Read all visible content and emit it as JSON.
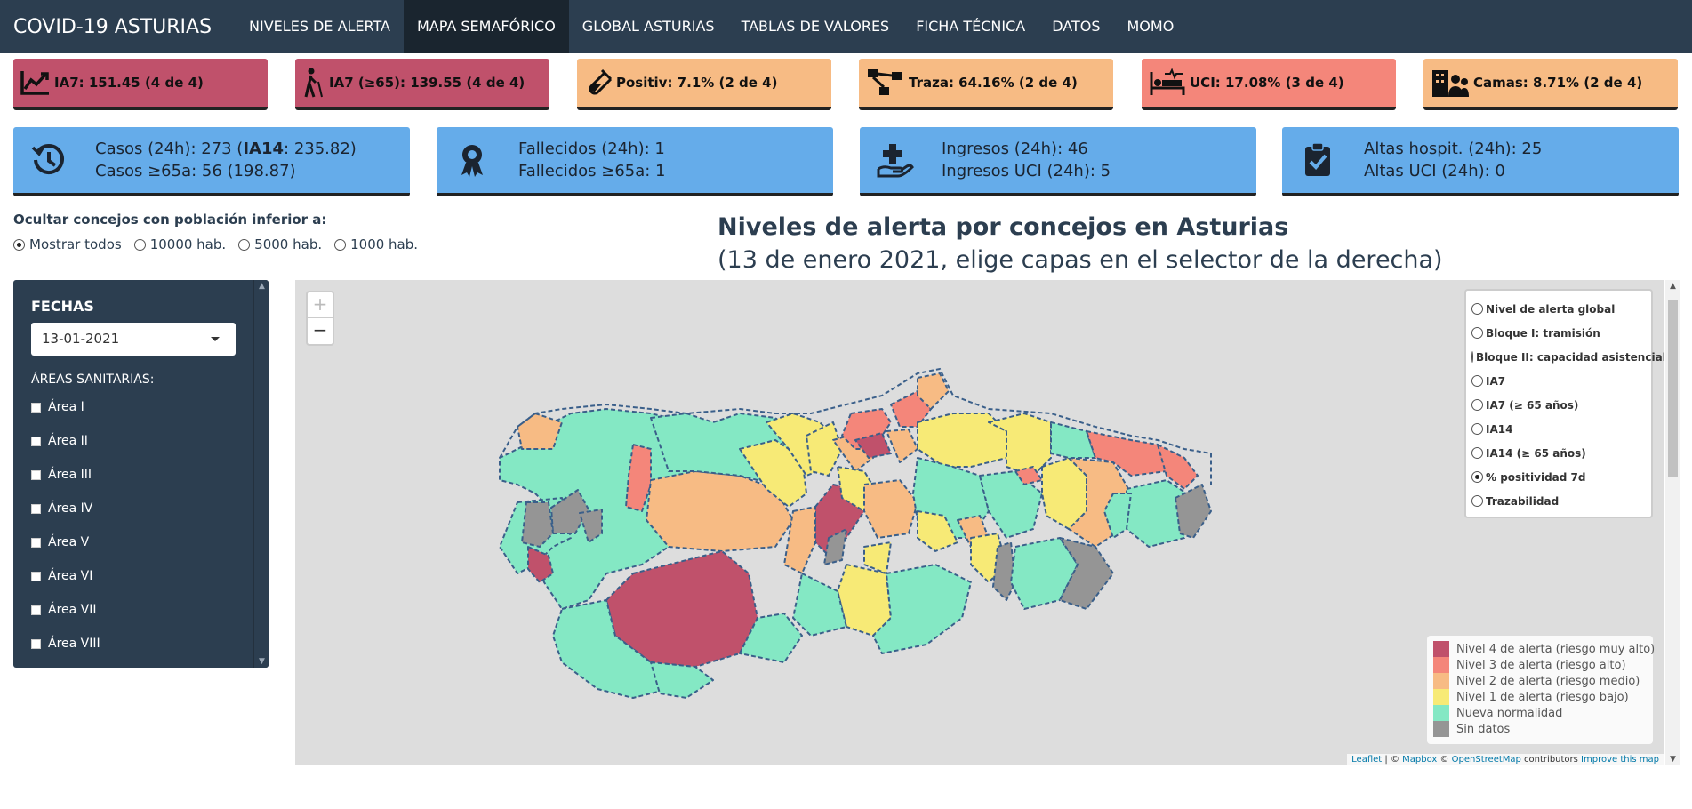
{
  "navbar": {
    "brand": "COVID-19 ASTURIAS",
    "items": [
      {
        "label": "NIVELES DE ALERTA"
      },
      {
        "label": "MAPA SEMAFÓRICO"
      },
      {
        "label": "GLOBAL ASTURIAS"
      },
      {
        "label": "TABLAS DE VALORES"
      },
      {
        "label": "FICHA TÉCNICA"
      },
      {
        "label": "DATOS"
      },
      {
        "label": "MOMO"
      }
    ],
    "active_item": "MAPA SEMAFÓRICO"
  },
  "indicators": [
    {
      "text": "IA7: 151.45 (4 de 4)",
      "icon": "chart-line-icon",
      "color": "#c0516b"
    },
    {
      "text": "IA7 (≥65): 139.55 (4 de 4)",
      "icon": "elderly-person-icon",
      "color": "#c0516b"
    },
    {
      "text": "Positiv: 7.1% (2 de 4)",
      "icon": "test-tube-icon",
      "color": "#f7bb84"
    },
    {
      "text": "Traza: 64.16% (2 de 4)",
      "icon": "network-icon",
      "color": "#f7bb84"
    },
    {
      "text": "UCI: 17.08% (3 de 4)",
      "icon": "hospital-bed-icon",
      "color": "#f4867a"
    },
    {
      "text": "Camas: 8.71% (2 de 4)",
      "icon": "hospital-building-icon",
      "color": "#f7bb84"
    }
  ],
  "info_boxes": [
    {
      "icon": "history-icon",
      "line1_pre": "Casos (24h): 273 (",
      "line1_bold": "IA14",
      "line1_post": ": 235.82)",
      "line2": "Casos ≥65a: 56 (198.87)"
    },
    {
      "icon": "ribbon-icon",
      "line1": "Fallecidos (24h): 1",
      "line2": "Fallecidos ≥65a: 1"
    },
    {
      "icon": "hand-plus-icon",
      "line1": "Ingresos (24h): 46",
      "line2": "Ingresos UCI (24h): 5"
    },
    {
      "icon": "clipboard-check-icon",
      "line1": "Altas hospit. (24h): 25",
      "line2": "Altas UCI (24h): 0"
    }
  ],
  "filter": {
    "title": "Ocultar concejos con población inferior a:",
    "options": [
      "Mostrar todos",
      "10000 hab.",
      "5000 hab.",
      "1000 hab."
    ],
    "selected": "Mostrar todos"
  },
  "map_header": {
    "title": "Niveles de alerta por concejos en Asturias",
    "subtitle": "(13 de enero 2021, elige capas en el selector de la derecha)"
  },
  "sidebar": {
    "dates_label": "FECHAS",
    "date_value": "13-01-2021",
    "areas_label": "ÁREAS SANITARIAS:",
    "areas": [
      "Área I",
      "Área II",
      "Área III",
      "Área IV",
      "Área V",
      "Área VI",
      "Área VII",
      "Área VIII"
    ]
  },
  "map": {
    "zoom_in": "+",
    "zoom_out": "−",
    "layers": [
      "Nivel de alerta global",
      "Bloque I: tramisión",
      "Bloque II: capacidad asistencial",
      "IA7",
      "IA7 (≥ 65 años)",
      "IA14",
      "IA14 (≥ 65 años)",
      "% positividad 7d",
      "Trazabilidad"
    ],
    "selected_layer": "% positividad 7d",
    "legend": [
      {
        "label": "Nivel 4 de alerta (riesgo muy alto)",
        "color": "#c0516b"
      },
      {
        "label": "Nivel 3 de alerta (riesgo alto)",
        "color": "#f4867a"
      },
      {
        "label": "Nivel 2 de alerta (riesgo medio)",
        "color": "#f7bb84"
      },
      {
        "label": "Nivel 1 de alerta (riesgo bajo)",
        "color": "#f7ea76"
      },
      {
        "label": "Nueva normalidad",
        "color": "#84e8c4"
      },
      {
        "label": "Sin datos",
        "color": "#959595"
      }
    ],
    "attribution": {
      "leaflet": "Leaflet",
      "sep1": " | © ",
      "mapbox": "Mapbox",
      "sep2": " © ",
      "osm": "OpenStreetMap",
      "contrib": " contributors ",
      "improve": "Improve this map"
    }
  }
}
